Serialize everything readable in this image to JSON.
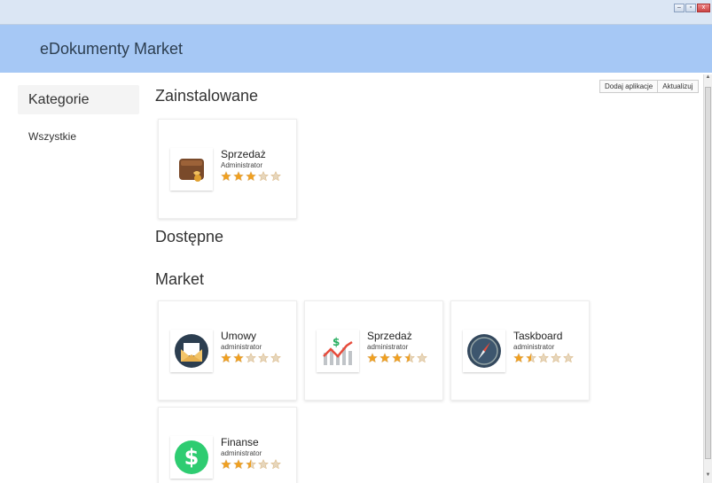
{
  "window": {
    "controls": {
      "minimize": "–",
      "maximize": "▫",
      "close": "x"
    }
  },
  "app": {
    "title": "eDokumenty Market"
  },
  "sidebar": {
    "title": "Kategorie",
    "items": [
      {
        "label": "Wszystkie"
      }
    ]
  },
  "toolbar": {
    "add_label": "Dodaj aplikacje",
    "update_label": "Aktualizuj"
  },
  "sections": {
    "installed": "Zainstalowane",
    "available": "Dostępne",
    "market": "Market"
  },
  "installed_apps": [
    {
      "name": "Sprzedaż",
      "author": "Administrator",
      "rating": 3,
      "icon": "wallet-icon"
    }
  ],
  "market_apps": [
    {
      "name": "Umowy",
      "author": "administrator",
      "rating": 2,
      "icon": "contract-envelope-icon"
    },
    {
      "name": "Sprzedaż",
      "author": "administrator",
      "rating": 3.5,
      "icon": "sales-chart-icon"
    },
    {
      "name": "Taskboard",
      "author": "administrator",
      "rating": 1.5,
      "icon": "compass-icon"
    },
    {
      "name": "Finanse",
      "author": "administrator",
      "rating": 2.5,
      "icon": "dollar-icon"
    }
  ],
  "colors": {
    "appbar": "#a6c8f5",
    "star": "#f0a020",
    "star_empty": "#e6d6bc"
  }
}
